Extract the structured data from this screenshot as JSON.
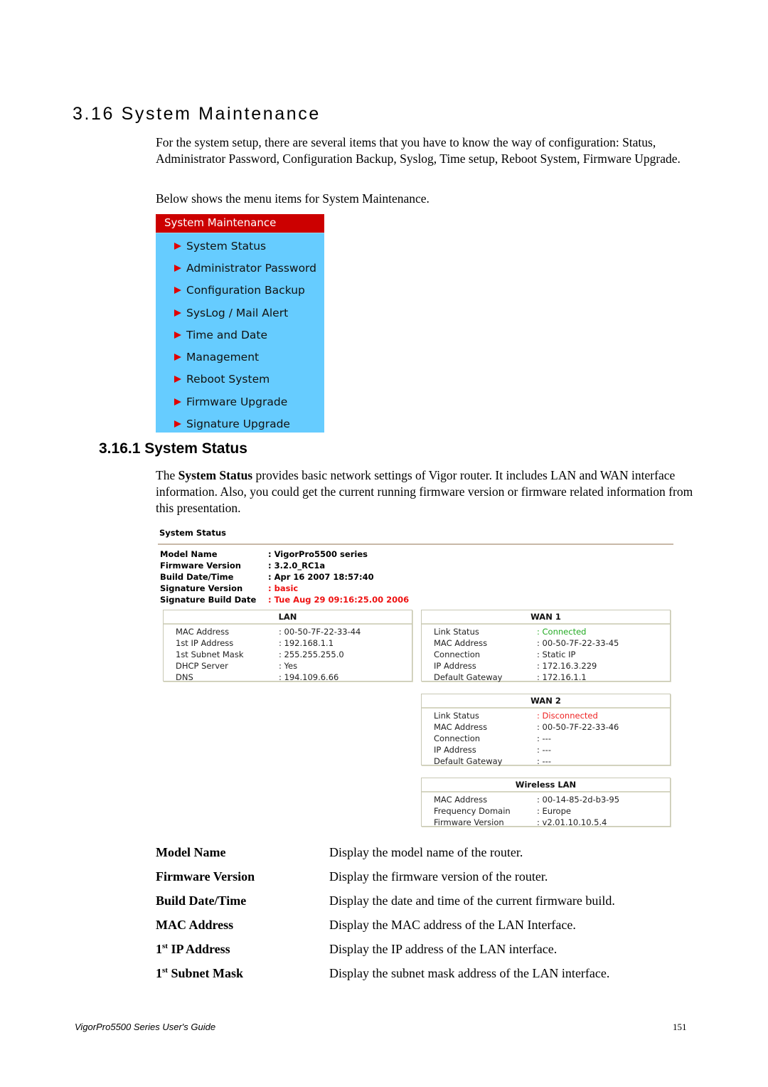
{
  "section": {
    "title": "3.16 System Maintenance",
    "intro": "For the system setup, there are several items that you have to know the way of configuration: Status, Administrator Password, Configuration Backup, Syslog, Time setup, Reboot System, Firmware Upgrade.",
    "menu_caption": "Below shows the menu items for System Maintenance."
  },
  "menu": {
    "header": "System Maintenance",
    "items": [
      {
        "label": "System Status"
      },
      {
        "label": "Administrator Password"
      },
      {
        "label": "Configuration Backup"
      },
      {
        "label": "SysLog / Mail Alert"
      },
      {
        "label": "Time and Date"
      },
      {
        "label": "Management"
      },
      {
        "label": "Reboot System"
      },
      {
        "label": "Firmware Upgrade"
      },
      {
        "label": "Signature Upgrade"
      }
    ],
    "colors": {
      "header_bg": "#cc0000",
      "body_bg": "#66ccff",
      "arrow": "#e00000"
    }
  },
  "subsection": {
    "title": "3.16.1 System Status",
    "intro_prefix": "The ",
    "intro_bold": "System Status",
    "intro_rest": " provides basic network settings of Vigor router. It includes LAN and WAN interface information. Also, you could get the current running firmware version or firmware related information from this presentation."
  },
  "status_screen": {
    "title": "System Status",
    "info": [
      {
        "key": "Model Name",
        "value": ": VigorPro5500 series"
      },
      {
        "key": "Firmware Version",
        "value": ": 3.2.0_RC1a"
      },
      {
        "key": "Build Date/Time",
        "value": ": Apr 16 2007 18:57:40"
      },
      {
        "key": "Signature Version",
        "value": ": basic"
      },
      {
        "key": "Signature Build Date",
        "value": ": Tue Aug 29 09:16:25.00 2006"
      }
    ],
    "lan": {
      "title": "LAN",
      "rows": [
        {
          "key": "MAC Address",
          "value": ": 00-50-7F-22-33-44"
        },
        {
          "key": "1st IP Address",
          "value": ": 192.168.1.1"
        },
        {
          "key": "1st Subnet Mask",
          "value": ": 255.255.255.0"
        },
        {
          "key": "DHCP Server",
          "value": ":  Yes"
        },
        {
          "key": "DNS",
          "value": ": 194.109.6.66"
        }
      ]
    },
    "wan1": {
      "title": "WAN 1",
      "rows": [
        {
          "key": "Link Status",
          "value": ": Connected"
        },
        {
          "key": "MAC Address",
          "value": ": 00-50-7F-22-33-45"
        },
        {
          "key": "Connection",
          "value": ": Static IP"
        },
        {
          "key": "IP Address",
          "value": ": 172.16.3.229"
        },
        {
          "key": "Default Gateway",
          "value": ": 172.16.1.1"
        }
      ]
    },
    "wan2": {
      "title": "WAN 2",
      "rows": [
        {
          "key": "Link Status",
          "value": ": Disconnected"
        },
        {
          "key": "MAC Address",
          "value": ": 00-50-7F-22-33-46"
        },
        {
          "key": "Connection",
          "value": ": ---"
        },
        {
          "key": "IP Address",
          "value": ": ---"
        },
        {
          "key": "Default Gateway",
          "value": ": ---"
        }
      ]
    },
    "wlan": {
      "title": "Wireless LAN",
      "rows": [
        {
          "key": "MAC Address",
          "value": ": 00-14-85-2d-b3-95"
        },
        {
          "key": "Frequency Domain",
          "value": ":  Europe"
        },
        {
          "key": "Firmware Version",
          "value": ": v2.01.10.10.5.4"
        }
      ]
    },
    "colors": {
      "connected": "#22aa22",
      "disconnected": "#ee2222",
      "signature": "#ee1111"
    }
  },
  "definitions": [
    {
      "term": "Model Name",
      "desc": "Display the model name of the router."
    },
    {
      "term": "Firmware Version",
      "desc": "Display the firmware version of the router."
    },
    {
      "term": "Build Date/Time",
      "desc": "Display the date and time of the current firmware build."
    },
    {
      "term": "MAC Address",
      "desc": "Display the MAC address of the LAN Interface."
    },
    {
      "term_num": "1",
      "term_sup": "st",
      "term": " IP Address",
      "desc": "Display the IP address of the LAN interface."
    },
    {
      "term_num": "1",
      "term_sup": "st",
      "term": " Subnet Mask",
      "desc": "Display the subnet mask address of the LAN interface."
    }
  ],
  "footer": {
    "guide": "VigorPro5500 Series User's Guide",
    "page": "151"
  }
}
